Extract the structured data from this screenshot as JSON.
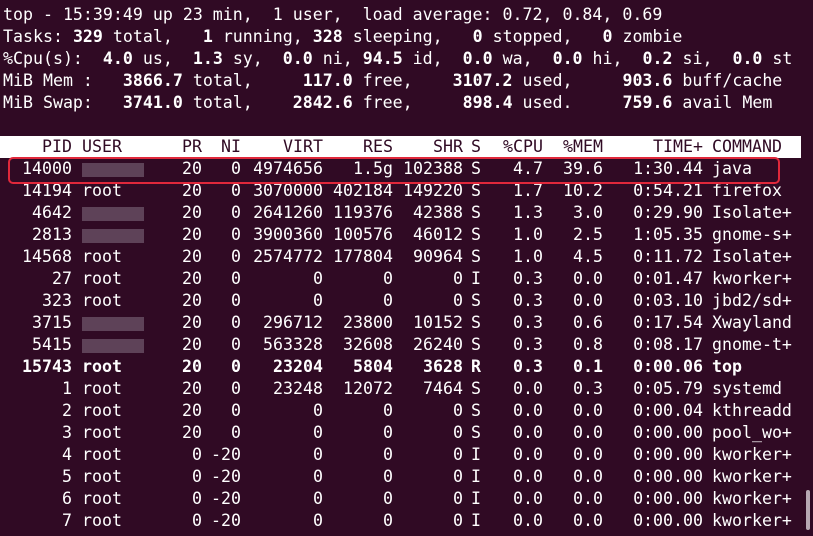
{
  "summary": {
    "line1": "top - 15:39:49 up 23 min,  1 user,  load average: 0.72, 0.84, 0.69",
    "tasks": {
      "label": "Tasks: ",
      "total": "329",
      "total_l": " total,   ",
      "running": "1",
      "running_l": " running, ",
      "sleeping": "328",
      "sleeping_l": " sleeping,   ",
      "stopped": "0",
      "stopped_l": " stopped,   ",
      "zombie": "0",
      "zombie_l": " zombie"
    },
    "cpu": {
      "label": "%Cpu(s):  ",
      "us": "4.0",
      "us_l": " us,  ",
      "sy": "1.3",
      "sy_l": " sy,  ",
      "ni": "0.0",
      "ni_l": " ni, ",
      "id": "94.5",
      "id_l": " id,  ",
      "wa": "0.0",
      "wa_l": " wa,  ",
      "hi": "0.0",
      "hi_l": " hi,  ",
      "si": "0.2",
      "si_l": " si,  ",
      "st": "0.0",
      "st_l": " st"
    },
    "mem": {
      "label": "MiB Mem :   ",
      "total": "3866.7",
      "total_l": " total,     ",
      "free": "117.0",
      "free_l": " free,    ",
      "used": "3107.2",
      "used_l": " used,     ",
      "buff": "903.6",
      "buff_l": " buff/cache"
    },
    "swap": {
      "label": "MiB Swap:   ",
      "total": "3741.0",
      "total_l": " total,    ",
      "free": "2842.6",
      "free_l": " free,     ",
      "used": "898.4",
      "used_l": " used.     ",
      "avail": "759.6",
      "avail_l": " avail Mem"
    }
  },
  "columns": {
    "pid": "PID",
    "user": "USER",
    "pr": "PR",
    "ni": "NI",
    "virt": "VIRT",
    "res": "RES",
    "shr": "SHR",
    "s": "S",
    "cpu": "%CPU",
    "mem": "%MEM",
    "time": "TIME+",
    "command": "COMMAND"
  },
  "processes": [
    {
      "pid": "14000",
      "user": "",
      "pr": "20",
      "ni": "0",
      "virt": "4974656",
      "res": "1.5g",
      "shr": "102388",
      "s": "S",
      "cpu": "4.7",
      "mem": "39.6",
      "time": "1:30.44",
      "command": "java"
    },
    {
      "pid": "14194",
      "user": "root",
      "pr": "20",
      "ni": "0",
      "virt": "3070000",
      "res": "402184",
      "shr": "149220",
      "s": "S",
      "cpu": "1.7",
      "mem": "10.2",
      "time": "0:54.21",
      "command": "firefox"
    },
    {
      "pid": "4642",
      "user": "",
      "pr": "20",
      "ni": "0",
      "virt": "2641260",
      "res": "119376",
      "shr": "42388",
      "s": "S",
      "cpu": "1.3",
      "mem": "3.0",
      "time": "0:29.90",
      "command": "Isolate+"
    },
    {
      "pid": "2813",
      "user": "",
      "pr": "20",
      "ni": "0",
      "virt": "3900360",
      "res": "100576",
      "shr": "46012",
      "s": "S",
      "cpu": "1.0",
      "mem": "2.5",
      "time": "1:05.35",
      "command": "gnome-s+"
    },
    {
      "pid": "14568",
      "user": "root",
      "pr": "20",
      "ni": "0",
      "virt": "2574772",
      "res": "177804",
      "shr": "90964",
      "s": "S",
      "cpu": "1.0",
      "mem": "4.5",
      "time": "0:11.72",
      "command": "Isolate+"
    },
    {
      "pid": "27",
      "user": "root",
      "pr": "20",
      "ni": "0",
      "virt": "0",
      "res": "0",
      "shr": "0",
      "s": "I",
      "cpu": "0.3",
      "mem": "0.0",
      "time": "0:01.47",
      "command": "kworker+"
    },
    {
      "pid": "323",
      "user": "root",
      "pr": "20",
      "ni": "0",
      "virt": "0",
      "res": "0",
      "shr": "0",
      "s": "S",
      "cpu": "0.3",
      "mem": "0.0",
      "time": "0:03.10",
      "command": "jbd2/sd+"
    },
    {
      "pid": "3715",
      "user": "",
      "pr": "20",
      "ni": "0",
      "virt": "296712",
      "res": "23800",
      "shr": "10152",
      "s": "S",
      "cpu": "0.3",
      "mem": "0.6",
      "time": "0:17.54",
      "command": "Xwayland"
    },
    {
      "pid": "5415",
      "user": "",
      "pr": "20",
      "ni": "0",
      "virt": "563328",
      "res": "32608",
      "shr": "26240",
      "s": "S",
      "cpu": "0.3",
      "mem": "0.8",
      "time": "0:08.17",
      "command": "gnome-t+"
    },
    {
      "pid": "15743",
      "user": "root",
      "pr": "20",
      "ni": "0",
      "virt": "23204",
      "res": "5804",
      "shr": "3628",
      "s": "R",
      "cpu": "0.3",
      "mem": "0.1",
      "time": "0:00.06",
      "command": "top"
    },
    {
      "pid": "1",
      "user": "root",
      "pr": "20",
      "ni": "0",
      "virt": "23248",
      "res": "12072",
      "shr": "7464",
      "s": "S",
      "cpu": "0.0",
      "mem": "0.3",
      "time": "0:05.79",
      "command": "systemd"
    },
    {
      "pid": "2",
      "user": "root",
      "pr": "20",
      "ni": "0",
      "virt": "0",
      "res": "0",
      "shr": "0",
      "s": "S",
      "cpu": "0.0",
      "mem": "0.0",
      "time": "0:00.04",
      "command": "kthreadd"
    },
    {
      "pid": "3",
      "user": "root",
      "pr": "20",
      "ni": "0",
      "virt": "0",
      "res": "0",
      "shr": "0",
      "s": "S",
      "cpu": "0.0",
      "mem": "0.0",
      "time": "0:00.00",
      "command": "pool_wo+"
    },
    {
      "pid": "4",
      "user": "root",
      "pr": "0",
      "ni": "-20",
      "virt": "0",
      "res": "0",
      "shr": "0",
      "s": "I",
      "cpu": "0.0",
      "mem": "0.0",
      "time": "0:00.00",
      "command": "kworker+"
    },
    {
      "pid": "5",
      "user": "root",
      "pr": "0",
      "ni": "-20",
      "virt": "0",
      "res": "0",
      "shr": "0",
      "s": "I",
      "cpu": "0.0",
      "mem": "0.0",
      "time": "0:00.00",
      "command": "kworker+"
    },
    {
      "pid": "6",
      "user": "root",
      "pr": "0",
      "ni": "-20",
      "virt": "0",
      "res": "0",
      "shr": "0",
      "s": "I",
      "cpu": "0.0",
      "mem": "0.0",
      "time": "0:00.00",
      "command": "kworker+"
    },
    {
      "pid": "7",
      "user": "root",
      "pr": "0",
      "ni": "-20",
      "virt": "0",
      "res": "0",
      "shr": "0",
      "s": "I",
      "cpu": "0.0",
      "mem": "0.0",
      "time": "0:00.00",
      "command": "kworker+"
    }
  ],
  "colors": {
    "background": "#300a24",
    "foreground": "#ffffff",
    "header_bg": "#ffffff",
    "highlight_border": "#e0283b",
    "redaction": "#5e4258"
  }
}
